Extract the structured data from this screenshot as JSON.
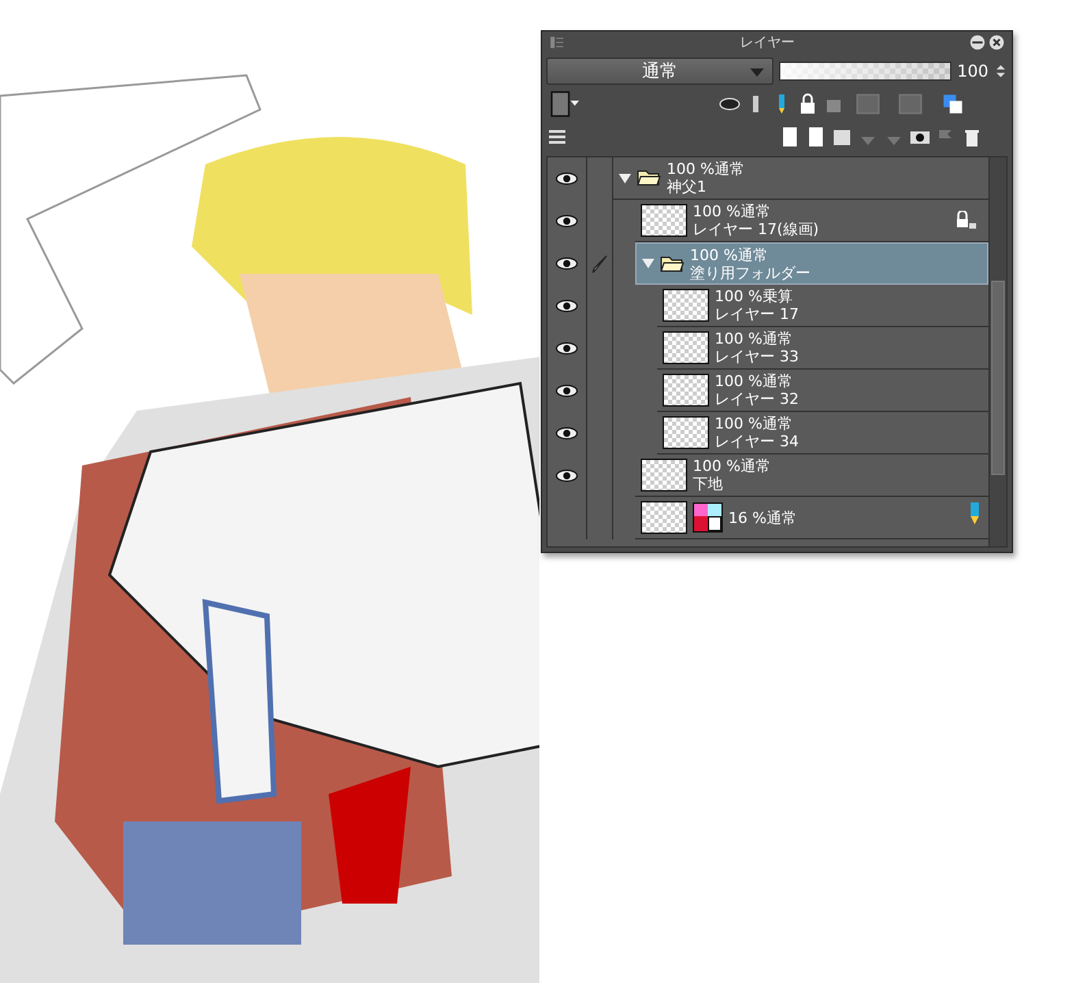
{
  "panel": {
    "title": "レイヤー",
    "blend_mode": "通常",
    "opacity": {
      "value": "100",
      "level": 1
    },
    "layers": [
      {
        "kind": "folder",
        "mode": "100 %通常",
        "name": "神父1",
        "visible": true,
        "selected": false,
        "expanded": true,
        "children": [
          {
            "kind": "layer",
            "mode": "100 %通常",
            "name": "レイヤー 17(線画)",
            "visible": true,
            "selected": false,
            "locked": true
          },
          {
            "kind": "folder",
            "mode": "100 %通常",
            "name": "塗り用フォルダー",
            "visible": true,
            "selected": true,
            "expanded": true,
            "children": [
              {
                "kind": "layer",
                "mode": "100 %乗算",
                "name": "レイヤー 17",
                "visible": true,
                "selected": false
              },
              {
                "kind": "layer",
                "mode": "100 %通常",
                "name": "レイヤー 33",
                "visible": true,
                "selected": false
              },
              {
                "kind": "layer",
                "mode": "100 %通常",
                "name": "レイヤー 32",
                "visible": true,
                "selected": false
              },
              {
                "kind": "layer",
                "mode": "100 %通常",
                "name": "レイヤー 34",
                "visible": true,
                "selected": false
              }
            ]
          },
          {
            "kind": "layer",
            "mode": "100 %通常",
            "name": "下地",
            "visible": true,
            "selected": false
          },
          {
            "kind": "swatch",
            "mode": "16 %通常",
            "visible": false,
            "selected": false,
            "pencil": true
          }
        ]
      }
    ]
  }
}
